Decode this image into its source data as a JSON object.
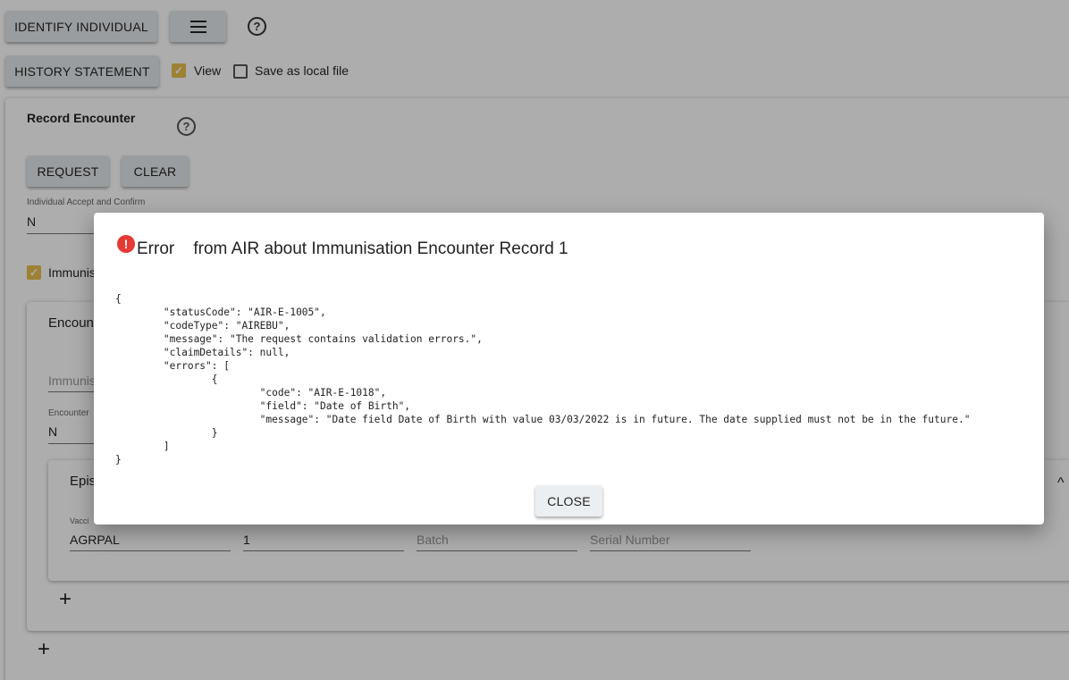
{
  "toolbar": {
    "identify_label": "IDENTIFY INDIVIDUAL",
    "menu_icon": "menu-icon",
    "help_icon": "?",
    "history_label": "HISTORY STATEMENT",
    "view_label": "View",
    "view_checked": true,
    "save_local_label": "Save as local file",
    "save_local_checked": false
  },
  "record": {
    "title": "Record Encounter",
    "help_icon": "?",
    "request_label": "REQUEST",
    "clear_label": "CLEAR",
    "accept_confirm_label": "Individual Accept and Confirm",
    "accept_confirm_value": "N",
    "immunisation_label": "Immunis",
    "encounter": {
      "title": "Encount",
      "immunisation_placeholder": "Immunis",
      "encounter_label": "Encounter",
      "encounter_value": "N",
      "episode": {
        "title": "Epis",
        "vaccine_label": "Vacci",
        "vaccine_value": "AGRPAL",
        "dose_value": "1",
        "batch_placeholder": "Batch",
        "serial_placeholder": "Serial Number"
      },
      "add_episode_icon": "+"
    },
    "add_encounter_icon": "+"
  },
  "dialog": {
    "title_prefix": "Error",
    "title_rest": "from AIR about Immunisation Encounter Record 1",
    "body": "{\n\t\"statusCode\": \"AIR-E-1005\",\n\t\"codeType\": \"AIREBU\",\n\t\"message\": \"The request contains validation errors.\",\n\t\"claimDetails\": null,\n\t\"errors\": [\n\t\t{\n\t\t\t\"code\": \"AIR-E-1018\",\n\t\t\t\"field\": \"Date of Birth\",\n\t\t\t\"message\": \"Date field Date of Birth with value 03/03/2022 is in future. The date supplied must not be in the future.\"\n\t\t}\n\t]\n}",
    "close_label": "CLOSE"
  },
  "colors": {
    "checkbox_accent": "#e8c04d",
    "error_icon": "#e53935",
    "button_bg": "#e4e7ea"
  }
}
